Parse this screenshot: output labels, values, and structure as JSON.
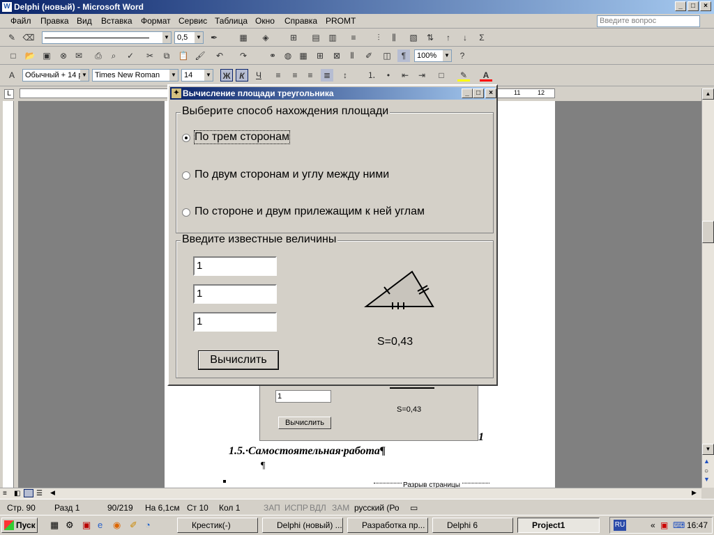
{
  "window": {
    "title": "Delphi (новый) - Microsoft Word"
  },
  "menu": [
    "Файл",
    "Правка",
    "Вид",
    "Вставка",
    "Формат",
    "Сервис",
    "Таблица",
    "Окно",
    "Справка",
    "PROMT"
  ],
  "ask_placeholder": "Введите вопрос",
  "toolbar": {
    "line_width": "0,5",
    "zoom": "100%",
    "style": "Обычный + 14 р",
    "font": "Times New Roman",
    "size": "14",
    "bold": "Ж",
    "italic": "К",
    "underline": "Ч"
  },
  "dialog": {
    "title": "Вычисление площади треугольника",
    "method_group": "Выберите способ нахождения площади",
    "options": [
      "По трем сторонам",
      "По двум сторонам и углу между ними",
      "По стороне и двум прилежащим к ней углам"
    ],
    "selected_option": 0,
    "values_group": "Введите известные величины",
    "inputs": [
      "1",
      "1",
      "1"
    ],
    "result": "S=0,43",
    "calc_button": "Вычислить"
  },
  "document": {
    "behind_input": "1",
    "behind_result": "S=0,43",
    "behind_button": "Вычислить",
    "side_number": "1",
    "heading": "1.5.·Самостоятельная·работа¶",
    "pilcrow": "¶",
    "page_break": "Разрыв страницы"
  },
  "ruler_ticks": [
    "11",
    "12"
  ],
  "status": {
    "page": "Стр.  90",
    "section": "Разд  1",
    "pages": "90/219",
    "at": "На 6,1см",
    "line": "Ст  10",
    "col": "Кол  1",
    "rec": "ЗАП",
    "trk": "ИСПР",
    "ext": "ВДЛ",
    "ovr": "ЗАМ",
    "lang": "русский (Ро"
  },
  "taskbar": {
    "start": "Пуск",
    "tasks": [
      "Крестик(-)",
      "Delphi (новый) ...",
      "Разработка пр...",
      "Delphi 6",
      "Project1"
    ],
    "lang": "RU",
    "time": "16:47"
  },
  "colors": {
    "title_start": "#0a246a",
    "title_end": "#a6caf0",
    "face": "#d4d0c8"
  }
}
